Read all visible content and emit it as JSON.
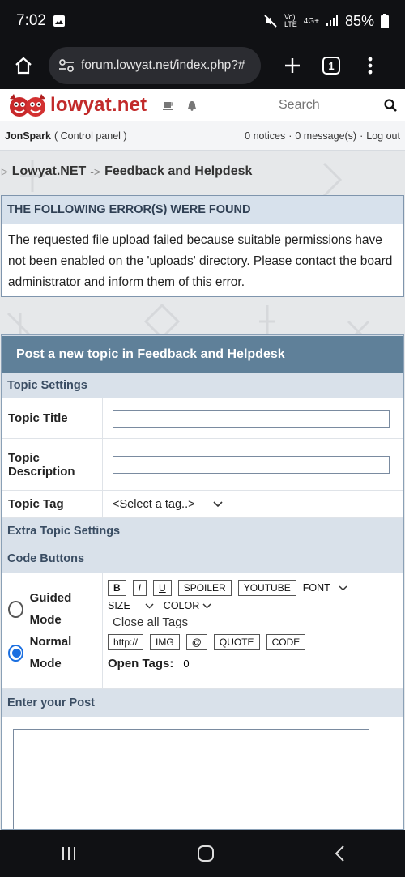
{
  "status": {
    "time": "7:02",
    "battery": "85%",
    "network": "4G+"
  },
  "browser": {
    "url": "forum.lowyat.net/index.php?#",
    "tab_count": "1"
  },
  "header": {
    "brand": "lowyat.net",
    "search_placeholder": "Search"
  },
  "userbar": {
    "username": "JonSpark",
    "control_panel": "( Control panel )",
    "notices": "0 notices",
    "messages": "0 message(s)",
    "logout": "Log out",
    "dot": "·"
  },
  "breadcrumb": {
    "home": "Lowyat.NET",
    "sep": "->",
    "current": "Feedback and Helpdesk"
  },
  "error": {
    "title": "THE FOLLOWING ERROR(S) WERE FOUND",
    "message": "The requested file upload failed because suitable permissions have not been enabled on the 'uploads' directory. Please contact the board administrator and inform them of this error."
  },
  "post": {
    "header": "Post a new topic in Feedback and Helpdesk",
    "topic_settings": "Topic Settings",
    "topic_title_label": "Topic Title",
    "topic_desc_label": "Topic Description",
    "topic_tag_label": "Topic Tag",
    "tag_select": "<Select a tag..>",
    "extra_settings": "Extra Topic Settings",
    "code_buttons": "Code Buttons",
    "guided_mode": "Guided Mode",
    "normal_mode": "Normal Mode",
    "btn_b": "B",
    "btn_i": "I",
    "btn_u": "U",
    "btn_spoiler": "SPOILER",
    "btn_youtube": "YOUTUBE",
    "font": "FONT",
    "size": "SIZE",
    "color": "COLOR",
    "close_tags": "Close all Tags",
    "btn_http": "http://",
    "btn_img": "IMG",
    "btn_at": "@",
    "btn_quote": "QUOTE",
    "btn_code": "CODE",
    "open_tags_label": "Open Tags:",
    "open_tags_value": "0",
    "enter_post": "Enter your Post"
  },
  "colors": {
    "accent": "#5f8099",
    "section": "#d9e1ea",
    "brand": "#c22a2a"
  }
}
